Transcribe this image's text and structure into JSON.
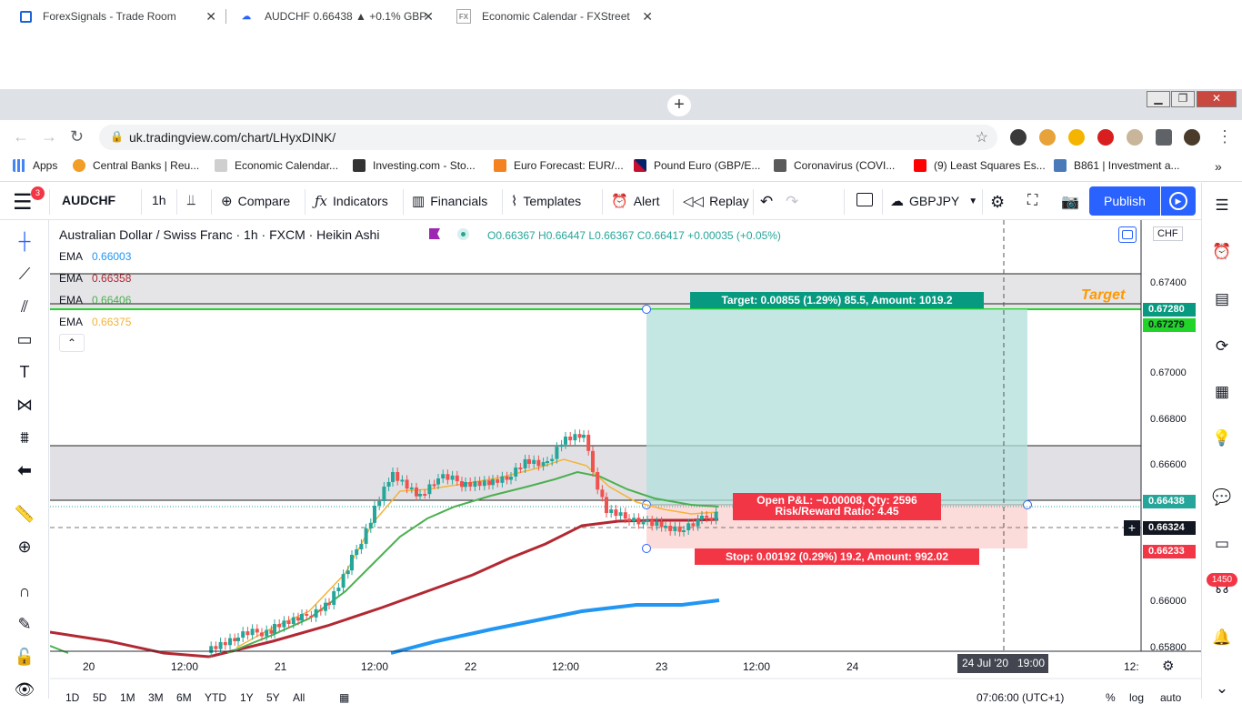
{
  "browser": {
    "tabs": [
      {
        "title": "ForexSignals - Trade Room"
      },
      {
        "title": "AUDCHF 0.66438 ▲ +0.1% GBPJP"
      },
      {
        "title": "Economic Calendar - FXStreet"
      }
    ],
    "url": "uk.tradingview.com/chart/LHyxDINK/",
    "bookmarks": [
      "Apps",
      "Central Banks | Reu...",
      "Economic Calendar...",
      "Investing.com - Sto...",
      "Euro Forecast: EUR/...",
      "Pound Euro (GBP/E...",
      "Coronavirus (COVI...",
      "(9) Least Squares Es...",
      "B861 | Investment a..."
    ]
  },
  "toolbar": {
    "notif_count": "3",
    "symbol": "AUDCHF",
    "interval": "1h",
    "compare": "Compare",
    "indicators": "Indicators",
    "financials": "Financials",
    "templates": "Templates",
    "alert": "Alert",
    "replay": "Replay",
    "layout_symbol": "GBPJPY",
    "publish": "Publish"
  },
  "chart": {
    "title": "Australian Dollar / Swiss Franc · 1h · FXCM · Heikin Ashi",
    "ohlc": "O0.66367  H0.66447  L0.66367  C0.66417  +0.00035 (+0.05%)",
    "currency": "CHF",
    "emas": [
      {
        "label": "EMA",
        "value": "0.66003",
        "color": "#2196f3"
      },
      {
        "label": "EMA",
        "value": "0.66358",
        "color": "#b22833"
      },
      {
        "label": "EMA",
        "value": "0.66406",
        "color": "#4caf50"
      },
      {
        "label": "EMA",
        "value": "0.66375",
        "color": "#f5b335"
      }
    ],
    "price_axis": [
      "0.67400",
      "0.67000",
      "0.66800",
      "0.66600",
      "0.66000",
      "0.65800"
    ],
    "price_tags": {
      "p1": "0.67280",
      "p2": "0.67279",
      "p3": "0.66438",
      "p4": "0.66324",
      "p5": "0.66233"
    },
    "time_axis": [
      "20",
      "12:00",
      "21",
      "12:00",
      "22",
      "12:00",
      "23",
      "12:00",
      "24",
      "12:"
    ],
    "crosshair_time": "24 Jul '20   19:00",
    "target_text": "Target",
    "target_label": "Target: 0.00855 (1.29%) 85.5, Amount: 1019.2",
    "stop_label": "Stop: 0.00192 (0.29%) 19.2, Amount: 992.02",
    "pnl_label": "Open P&L: −0.00008, Qty: 2596",
    "rr_label": "Risk/Reward Ratio: 4.45",
    "badge_count": "1450",
    "colors": {
      "up": "#26a69a",
      "down": "#ef5350",
      "target_zone": "#b2dfdb",
      "stop_zone": "#fbd6d5"
    }
  },
  "bottom": {
    "timeframes": [
      "1D",
      "5D",
      "1M",
      "3M",
      "6M",
      "YTD",
      "1Y",
      "5Y",
      "All"
    ],
    "clock": "07:06:00 (UTC+1)",
    "pct": "%",
    "log": "log",
    "auto": "auto"
  }
}
